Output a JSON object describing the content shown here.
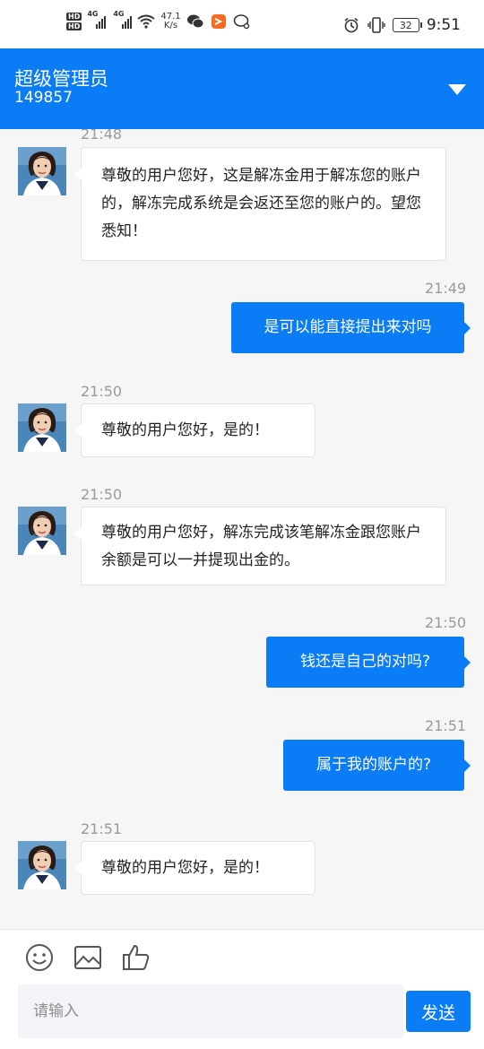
{
  "status_bar": {
    "network_speed_value": "47.1",
    "network_speed_unit": "K/s",
    "signal1_label": "4G",
    "signal2_label": "4G",
    "hd1": "HD",
    "hd2": "HD",
    "battery": "32",
    "time": "9:51"
  },
  "header": {
    "title": "超级管理员",
    "subtitle": "149857"
  },
  "messages": [
    {
      "time": "21:48",
      "text": "尊敬的用户您好，这是解冻金用于解冻您的账户的，解冻完成系统是会返还至您的账户的。望您悉知！"
    },
    {
      "time": "21:49",
      "text": "是可以能直接提出来对吗"
    },
    {
      "time": "21:50",
      "text": "尊敬的用户您好，是的！"
    },
    {
      "time": "21:50",
      "text": "尊敬的用户您好，解冻完成该笔解冻金跟您账户余额是可以一并提现出金的。"
    },
    {
      "time": "21:50",
      "text": "钱还是自己的对吗?"
    },
    {
      "time": "21:51",
      "text": "属于我的账户的?"
    },
    {
      "time": "21:51",
      "text": "尊敬的用户您好，是的！"
    }
  ],
  "composer": {
    "placeholder": "请输入",
    "send_label": "发送"
  },
  "colors": {
    "accent": "#0a7cf6",
    "chat_bg": "#f6f6f6"
  },
  "icons": [
    "hd-icon",
    "signal-icon",
    "wifi-icon",
    "wechat-icon",
    "app-icon",
    "chat-search-icon",
    "alarm-icon",
    "vibrate-icon",
    "battery-icon",
    "dropdown-arrow-icon",
    "emoji-icon",
    "image-icon",
    "thumbs-up-icon"
  ]
}
